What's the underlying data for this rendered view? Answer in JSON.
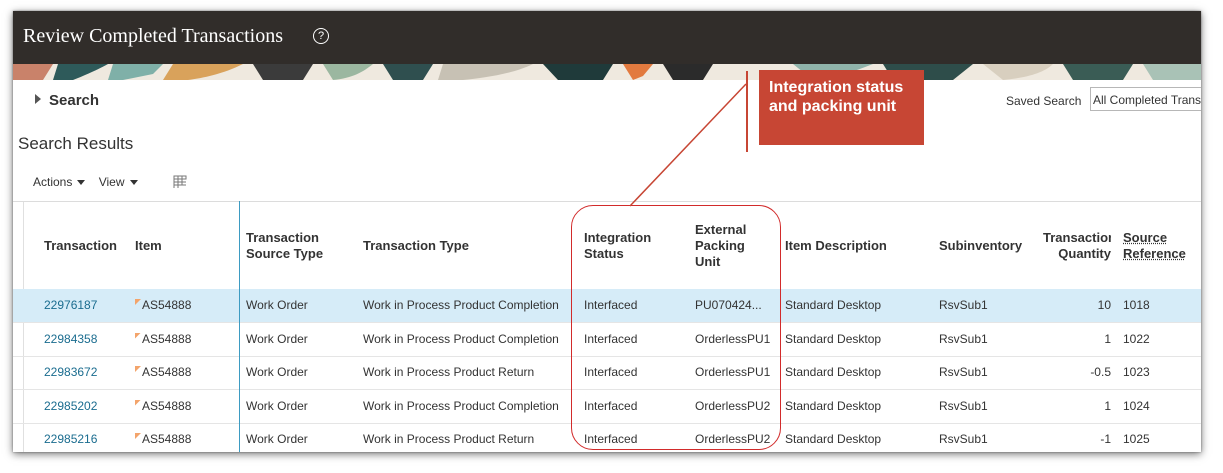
{
  "page": {
    "title": "Review Completed Transactions",
    "help_icon": "question-circle-icon"
  },
  "search": {
    "toggle_label": "Search",
    "saved_search_label": "Saved Search",
    "saved_search_value": "All Completed Trans"
  },
  "results": {
    "title": "Search Results",
    "actions_label": "Actions",
    "view_label": "View",
    "freeze_icon": "freeze-columns-icon"
  },
  "callout": {
    "text": "Integration status and packing unit",
    "color": "#c74634"
  },
  "table": {
    "headers": {
      "transaction": "Transaction",
      "item": "Item",
      "source_type": "Transaction Source Type",
      "type": "Transaction Type",
      "integration_status": "Integration Status",
      "packing_unit": "External Packing Unit",
      "item_description": "Item Description",
      "subinventory": "Subinventory",
      "quantity": "Transaction Quantity",
      "source_reference": "Source Reference"
    },
    "rows": [
      {
        "transaction": "22976187",
        "item": "AS54888",
        "source_type": "Work Order",
        "type": "Work in Process Product Completion",
        "integration_status": "Interfaced",
        "packing_unit": "PU070424...",
        "item_description": "Standard Desktop",
        "subinventory": "RsvSub1",
        "quantity": "10",
        "source_reference": "1018"
      },
      {
        "transaction": "22984358",
        "item": "AS54888",
        "source_type": "Work Order",
        "type": "Work in Process Product Completion",
        "integration_status": "Interfaced",
        "packing_unit": "OrderlessPU1",
        "item_description": "Standard Desktop",
        "subinventory": "RsvSub1",
        "quantity": "1",
        "source_reference": "1022"
      },
      {
        "transaction": "22983672",
        "item": "AS54888",
        "source_type": "Work Order",
        "type": "Work in Process Product Return",
        "integration_status": "Interfaced",
        "packing_unit": "OrderlessPU1",
        "item_description": "Standard Desktop",
        "subinventory": "RsvSub1",
        "quantity": "-0.5",
        "source_reference": "1023"
      },
      {
        "transaction": "22985202",
        "item": "AS54888",
        "source_type": "Work Order",
        "type": "Work in Process Product Completion",
        "integration_status": "Interfaced",
        "packing_unit": "OrderlessPU2",
        "item_description": "Standard Desktop",
        "subinventory": "RsvSub1",
        "quantity": "1",
        "source_reference": "1024"
      },
      {
        "transaction": "22985216",
        "item": "AS54888",
        "source_type": "Work Order",
        "type": "Work in Process Product Return",
        "integration_status": "Interfaced",
        "packing_unit": "OrderlessPU2",
        "item_description": "Standard Desktop",
        "subinventory": "RsvSub1",
        "quantity": "-1",
        "source_reference": "1025"
      }
    ],
    "selected_row_index": 0
  },
  "colors": {
    "title_bar": "#312d2a",
    "link": "#1a6c8f",
    "selected_row": "#d6ecf8",
    "highlight_border": "#d22b2b"
  }
}
